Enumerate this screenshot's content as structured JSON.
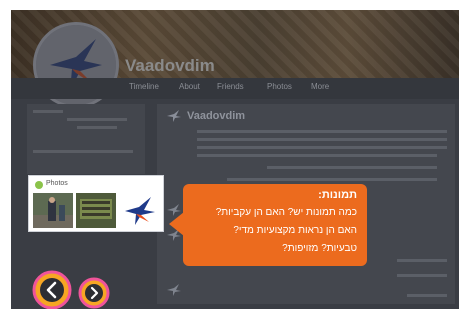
{
  "page": {
    "name": "Vaadovdim",
    "tabs": [
      "Timeline",
      "About",
      "Friends",
      "Photos",
      "More"
    ],
    "feed_title": "Vaadovdim"
  },
  "photos_card": {
    "label": "Photos"
  },
  "callout": {
    "title": "תמונות:",
    "lines": [
      "כמה תמונות יש? האם הן עקביות?",
      "האם הן נראות מקצועיות מדי?",
      "טבעיות? מזויפות?"
    ]
  },
  "colors": {
    "callout_bg": "#ec6b1e",
    "nav_prev_ring": "#f0549a",
    "nav_next_ring": "#f0549a",
    "nav_fill": "#f6a623"
  },
  "icons": {
    "prev": "chevron-left-icon",
    "next": "chevron-right-icon",
    "logo": "star-logo-icon"
  }
}
